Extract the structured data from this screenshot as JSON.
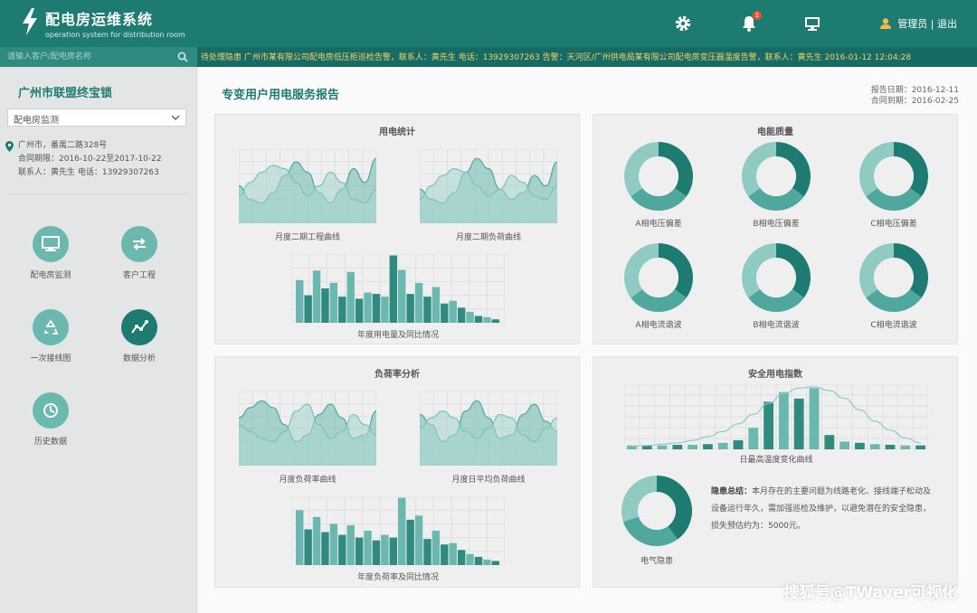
{
  "app": {
    "title": "配电房运维系统",
    "subtitle": "operation system for distribution room"
  },
  "header": {
    "bell_count": "1",
    "user_label": "管理员 | 退出"
  },
  "search": {
    "placeholder": "请输入客户/配电房名称"
  },
  "ticker": "待处理隐患 广州市某有限公司配电房低压柜巡检告警，联系人：黄先生  电话：13929307263     告警：天河区/广州供电局某有限公司配电房变压器温度告警，联系人：黄先生     2016-01-12 12:04:28",
  "sidebar": {
    "title": "广州市联盟终宝锁",
    "select_value": "配电房监测",
    "info": [
      "广州市，番禺二路328号",
      "合同期限：2016-10-22至2017-10-22",
      "联系人：黄先生  电话：13929307263"
    ],
    "nav": [
      {
        "label": "配电房监测",
        "icon": "monitor-icon"
      },
      {
        "label": "客户工程",
        "icon": "switch-icon"
      },
      {
        "label": "一次接线图",
        "icon": "recycle-icon"
      },
      {
        "label": "数据分析",
        "icon": "trend-icon"
      },
      {
        "label": "历史数据",
        "icon": "history-icon"
      }
    ]
  },
  "main": {
    "title": "专变用户用电服务报告",
    "report_date": "报告日期：2016-12-11",
    "contract_date": "合同到期：2016-02-25"
  },
  "panels": {
    "tl": {
      "title": "用电统计",
      "chart1": "月度二期工程曲线",
      "chart2": "月度二期负荷曲线",
      "chart3": "年度用电量及同比情况"
    },
    "tr": {
      "title": "电能质量",
      "labels": [
        "A相电压偏差",
        "B相电压偏差",
        "C相电压偏差",
        "A相电流谐波",
        "B相电流谐波",
        "C相电流谐波"
      ]
    },
    "bl": {
      "title": "负荷率分析",
      "chart1": "月度负荷率曲线",
      "chart2": "月度日平均负荷曲线",
      "chart3": "年度负荷率及同比情况"
    },
    "br": {
      "title": "安全用电指数",
      "chart1": "日最高温度变化曲线",
      "donut_label": "电气隐患",
      "desc_title": "隐患总结：",
      "desc_text": "本月存在的主要问题为线路老化、接线端子松动及设备运行年久，需加强巡检及维护，以避免潜在的安全隐患，损失预估约为：5000元。"
    }
  },
  "watermark": "搜狐号@TWaver可视化",
  "colors": {
    "primary": "#1d7b72",
    "light": "#6ab8b0",
    "pale": "#a9d6d1"
  },
  "chart_data": [
    {
      "type": "area",
      "title": "月度二期工程曲线",
      "series": [
        {
          "values": [
            0.55,
            0.35,
            0.3,
            0.45,
            0.7,
            0.9,
            0.75,
            0.45,
            0.3,
            0.5,
            0.8,
            0.6,
            0.95
          ]
        },
        {
          "values": [
            0.4,
            0.6,
            0.75,
            0.85,
            0.8,
            0.6,
            0.4,
            0.55,
            0.75,
            0.6,
            0.35,
            0.3,
            0.5
          ]
        }
      ]
    },
    {
      "type": "area",
      "title": "月度二期负荷曲线",
      "series": [
        {
          "values": [
            0.5,
            0.35,
            0.3,
            0.45,
            0.75,
            0.95,
            0.8,
            0.5,
            0.35,
            0.45,
            0.7,
            0.55,
            0.9
          ]
        },
        {
          "values": [
            0.35,
            0.55,
            0.7,
            0.8,
            0.75,
            0.55,
            0.4,
            0.5,
            0.7,
            0.6,
            0.4,
            0.35,
            0.55
          ]
        }
      ]
    },
    {
      "type": "bar",
      "title": "年度用电量及同比情况",
      "series": [
        {
          "values": [
            0.62,
            0.76,
            0.58,
            0.74,
            0.44,
            0.38,
            0.77,
            0.58,
            0.52,
            0.32,
            0.16,
            0.08
          ]
        },
        {
          "values": [
            0.4,
            0.5,
            0.38,
            0.35,
            0.42,
            0.98,
            0.42,
            0.38,
            0.28,
            0.22,
            0.1,
            0.05
          ]
        }
      ]
    },
    {
      "type": "area",
      "title": "月度负荷率曲线",
      "series": [
        {
          "values": [
            0.7,
            0.85,
            0.95,
            0.85,
            0.6,
            0.35,
            0.45,
            0.75,
            0.9,
            0.7,
            0.4,
            0.45,
            0.8
          ]
        },
        {
          "values": [
            0.6,
            0.5,
            0.4,
            0.35,
            0.5,
            0.8,
            0.9,
            0.6,
            0.4,
            0.5,
            0.75,
            0.6,
            0.45
          ]
        }
      ]
    },
    {
      "type": "area",
      "title": "月度日平均负荷曲线",
      "series": [
        {
          "values": [
            0.75,
            0.6,
            0.35,
            0.45,
            0.8,
            0.95,
            0.7,
            0.4,
            0.45,
            0.75,
            0.9,
            0.65,
            0.5
          ]
        },
        {
          "values": [
            0.55,
            0.7,
            0.8,
            0.7,
            0.5,
            0.4,
            0.55,
            0.75,
            0.7,
            0.45,
            0.35,
            0.55,
            0.7
          ]
        }
      ]
    },
    {
      "type": "bar",
      "title": "年度负荷率及同比情况",
      "series": [
        {
          "values": [
            0.8,
            0.7,
            0.6,
            0.58,
            0.5,
            0.44,
            0.98,
            0.72,
            0.5,
            0.32,
            0.16,
            0.08
          ]
        },
        {
          "values": [
            0.52,
            0.48,
            0.44,
            0.4,
            0.36,
            0.4,
            0.66,
            0.38,
            0.3,
            0.22,
            0.12,
            0.06
          ]
        }
      ]
    },
    {
      "type": "bar",
      "title": "日最高温度变化曲线",
      "values": [
        0.06,
        0.06,
        0.06,
        0.07,
        0.07,
        0.08,
        0.1,
        0.14,
        0.33,
        0.73,
        0.88,
        0.78,
        0.94,
        0.22,
        0.12,
        0.1,
        0.08,
        0.07,
        0.06,
        0.06
      ],
      "line": [
        0.05,
        0.06,
        0.08,
        0.1,
        0.14,
        0.2,
        0.28,
        0.4,
        0.55,
        0.72,
        0.88,
        0.96,
        0.98,
        0.92,
        0.8,
        0.62,
        0.44,
        0.3,
        0.18,
        0.1
      ]
    }
  ]
}
